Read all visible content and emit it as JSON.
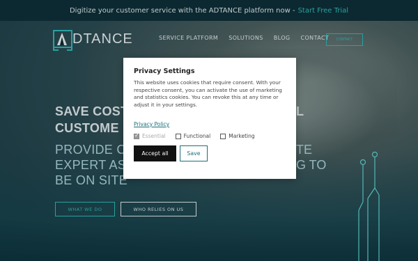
{
  "topbar": {
    "text": "Digitize your customer service with the ADTANCE platform now -",
    "link": "Start Free Trial"
  },
  "brand": {
    "name": "DTANCE",
    "accent": "#2fb8b5"
  },
  "nav": {
    "items": [
      "SERVICE PLATFORM",
      "SOLUTIONS",
      "BLOG",
      "CONTACT"
    ],
    "cta": "CONTACT"
  },
  "hero": {
    "headline_line1": "SAVE COST",
    "headline_line1_end": "L",
    "headline_line2": "CUSTOME",
    "sub_line1": "PROVIDE C",
    "sub_line1_end": "TE",
    "sub_line2": "EXPERT AS",
    "sub_line2_end": "G TO",
    "sub_line3": "BE ON SITE",
    "btn_what": "WHAT WE DO",
    "btn_who": "WHO RELIES ON US"
  },
  "modal": {
    "title": "Privacy Settings",
    "body": "This website uses cookies that require consent. With your respective consent, you can activate the use of marketing and statistics cookies. You can revoke this at any time or adjust it in your settings.",
    "policy_link": "Privacy Policy",
    "checkboxes": [
      {
        "label": "Essential",
        "checked": true,
        "disabled": true
      },
      {
        "label": "Functional",
        "checked": false,
        "disabled": false
      },
      {
        "label": "Marketing",
        "checked": false,
        "disabled": false
      }
    ],
    "accept_label": "Accept all",
    "save_label": "Save"
  }
}
